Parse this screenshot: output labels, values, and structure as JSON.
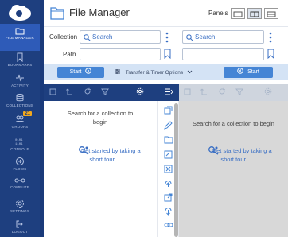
{
  "app": {
    "title": "File Manager"
  },
  "header": {
    "panels_label": "Panels"
  },
  "sidebar": {
    "items": [
      {
        "label": "File Manager",
        "icon": "file-manager-icon",
        "active": true
      },
      {
        "label": "Bookmarks",
        "icon": "bookmark-icon"
      },
      {
        "label": "Activity",
        "icon": "activity-icon"
      },
      {
        "label": "Collections",
        "icon": "collections-icon"
      },
      {
        "label": "Groups",
        "icon": "groups-icon",
        "badge": "21"
      },
      {
        "label": "Console",
        "icon": "console-icon"
      },
      {
        "label": "Flows",
        "icon": "flows-icon"
      },
      {
        "label": "Compute",
        "icon": "compute-icon"
      },
      {
        "label": "Settings",
        "icon": "settings-icon"
      },
      {
        "label": "Logout",
        "icon": "logout-icon"
      }
    ]
  },
  "form": {
    "collection_label": "Collection",
    "path_label": "Path",
    "left_search_placeholder": "Search",
    "right_search_placeholder": "Search"
  },
  "actions": {
    "start_left": "Start",
    "transfer_options": "Transfer & Timer Options",
    "start_right": "Start"
  },
  "left_pane": {
    "empty_message": "Search for a collection to begin",
    "tour_link": "Get started by taking a short tour."
  },
  "right_pane": {
    "empty_message": "Search for a collection to begin",
    "tour_link": "Get started by taking a short tour."
  },
  "colors": {
    "sidebar_bg": "#1e3f7f",
    "active_nav": "#2e5bb8",
    "accent_blue": "#4585d5",
    "link_blue": "#3a6fc4",
    "badge": "#f2a81d"
  }
}
